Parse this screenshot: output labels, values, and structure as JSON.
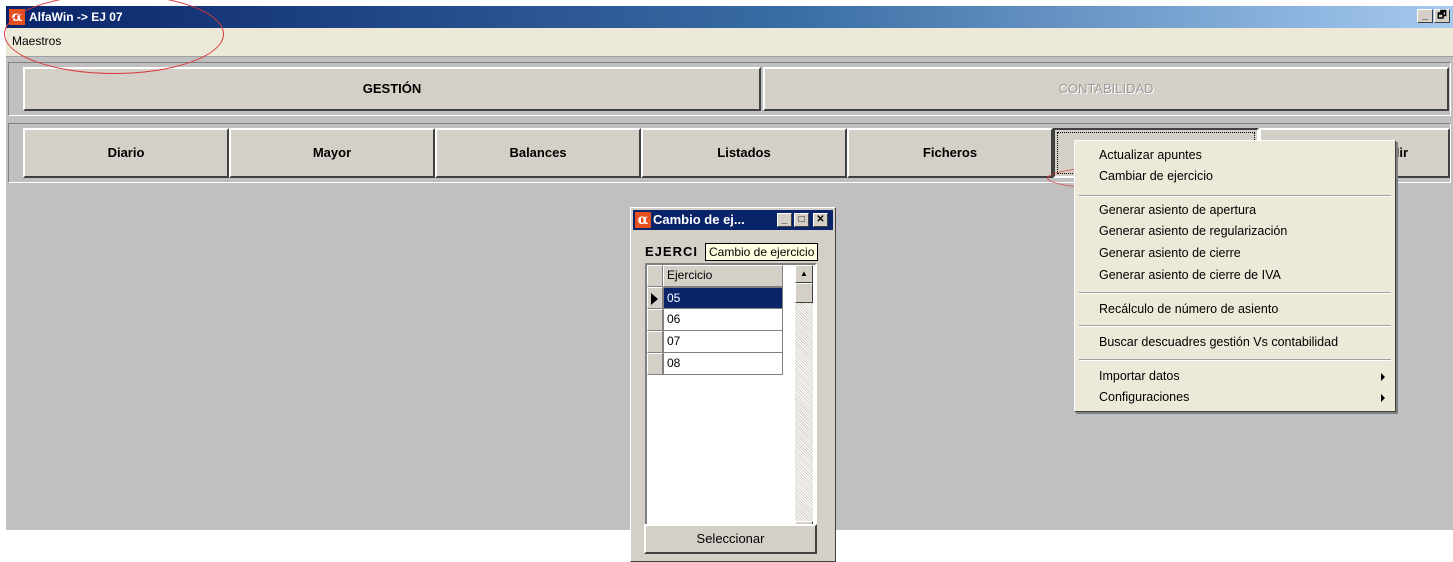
{
  "window": {
    "logo_glyph": "α",
    "title": "AlfaWin -> EJ 07",
    "minimize_glyph": "_",
    "restore_glyph": "🗗"
  },
  "menubar": {
    "items": [
      {
        "label": "Maestros"
      }
    ]
  },
  "modules": [
    {
      "label": "GESTIÓN",
      "state": "active"
    },
    {
      "label": "CONTABILIDAD",
      "state": "disabled"
    }
  ],
  "toolbar": {
    "buttons": [
      {
        "label": "Diario"
      },
      {
        "label": "Mayor"
      },
      {
        "label": "Balances"
      },
      {
        "label": "Listados"
      },
      {
        "label": "Ficheros"
      },
      {
        "label": ""
      },
      {
        "label": "alir"
      }
    ]
  },
  "popup_menu": {
    "items": [
      {
        "label": "Actualizar apuntes"
      },
      {
        "label": "Cambiar de ejercicio"
      },
      {
        "label": "Generar asiento de apertura"
      },
      {
        "label": "Generar asiento de regularización"
      },
      {
        "label": "Generar asiento de cierre"
      },
      {
        "label": "Generar asiento de cierre de IVA"
      },
      {
        "label": "Recálculo de número de asiento"
      },
      {
        "label": "Buscar descuadres gestión Vs contabilidad"
      },
      {
        "label": "Importar datos",
        "submenu": true
      },
      {
        "label": "Configuraciones",
        "submenu": true
      }
    ]
  },
  "dialog": {
    "title": "Cambio de ej...",
    "ctrl_min": "_",
    "ctrl_max": "□",
    "ctrl_close": "✕",
    "label": "EJERCI",
    "tooltip": "Cambio de ejercicio",
    "column_header": "Ejercicio",
    "rows": [
      "05",
      "06",
      "07",
      "08"
    ],
    "selected_index": 0,
    "scroll_up": "▲",
    "scroll_down": "▼",
    "select_button": "Seleccionar"
  },
  "colors": {
    "title_blue": "#0a246a",
    "face": "#d4d0c8",
    "annotation_red": "#d93a3a",
    "tooltip_bg": "#ffffe1"
  }
}
